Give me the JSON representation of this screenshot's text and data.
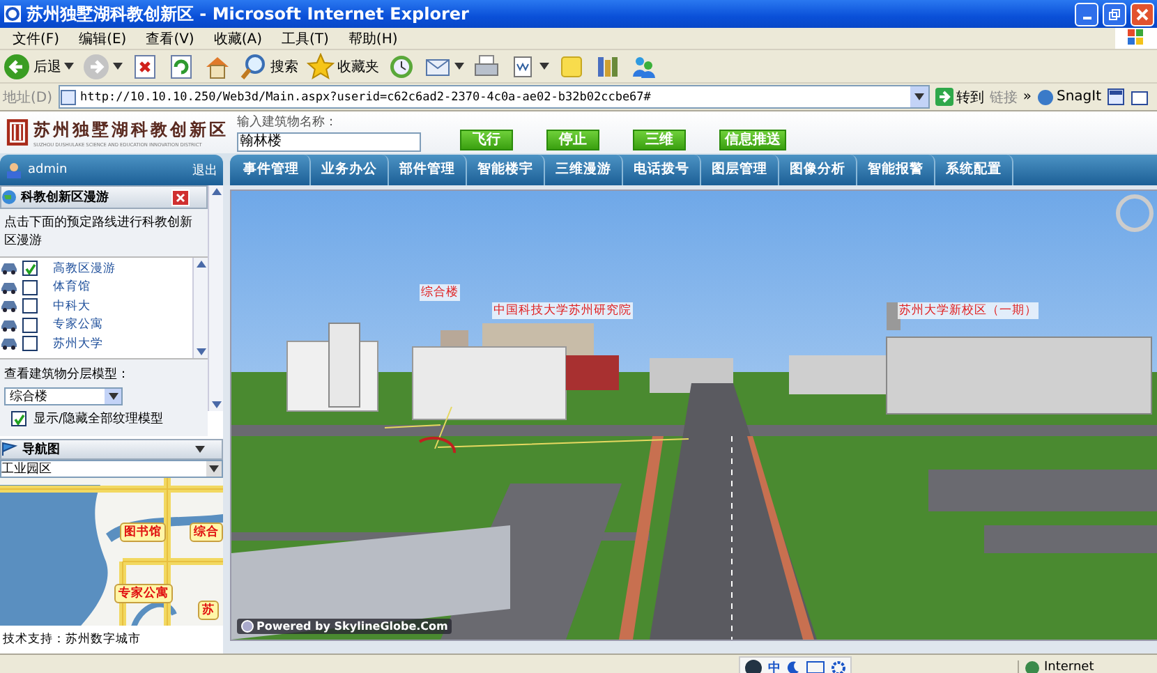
{
  "window": {
    "title": "苏州独墅湖科教创新区 - Microsoft Internet Explorer"
  },
  "menu": [
    "文件(F)",
    "编辑(E)",
    "查看(V)",
    "收藏(A)",
    "工具(T)",
    "帮助(H)"
  ],
  "toolbar": [
    {
      "kind": "back",
      "label": "后退"
    },
    {
      "kind": "forward"
    },
    {
      "kind": "stop"
    },
    {
      "kind": "refresh"
    },
    {
      "kind": "home"
    },
    {
      "kind": "search",
      "label": "搜索"
    },
    {
      "kind": "favorites",
      "label": "收藏夹"
    },
    {
      "kind": "history"
    },
    {
      "kind": "mail"
    },
    {
      "kind": "print"
    },
    {
      "kind": "edit"
    },
    {
      "kind": "note"
    },
    {
      "kind": "research"
    },
    {
      "kind": "messenger"
    }
  ],
  "address_bar": {
    "label": "地址(D)",
    "url": "http://10.10.10.250/Web3d/Main.aspx?userid=c62c6ad2-2370-4c0a-ae02-b32b02ccbe67#",
    "go": "转到",
    "links": "链接",
    "more": "»",
    "snagit": "SnagIt"
  },
  "header": {
    "logo_title": "苏州独墅湖科教创新区",
    "logo_subtitle": "SUZHOU DUSHULAKE SCIENCE AND EDUCATION INNOVATION DISTRICT",
    "search_label": "输入建筑物名称：",
    "search_value": "翰林楼",
    "buttons": [
      "飞行",
      "停止",
      "三维",
      "信息推送"
    ]
  },
  "user": {
    "name": "admin",
    "logout": "退出"
  },
  "nav_tabs": [
    {
      "label": "事件管理",
      "selected": false
    },
    {
      "label": "业务办公",
      "selected": false
    },
    {
      "label": "部件管理",
      "selected": false
    },
    {
      "label": "智能楼宇",
      "selected": false
    },
    {
      "label": "三维漫游",
      "selected": false
    },
    {
      "label": "电话拨号",
      "selected": false
    },
    {
      "label": "图层管理",
      "selected": false
    },
    {
      "label": "图像分析",
      "selected": false
    },
    {
      "label": "智能报警",
      "selected": false
    },
    {
      "label": "系统配置",
      "selected": false
    }
  ],
  "tour_panel": {
    "title": "科教创新区漫游",
    "instruction": "点击下面的预定路线进行科教创新区漫游",
    "routes": [
      {
        "label": "高教区漫游",
        "checked": true
      },
      {
        "label": "体育馆",
        "checked": false
      },
      {
        "label": "中科大",
        "checked": false
      },
      {
        "label": "专家公寓",
        "checked": false
      },
      {
        "label": "苏州大学",
        "checked": false
      }
    ],
    "layer_label": "查看建筑物分层模型：",
    "layer_select": "综合楼",
    "texture_toggle": {
      "label": "显示/隐藏全部纹理模型",
      "checked": true
    }
  },
  "nav_map": {
    "title": "导航图",
    "area_select": "工业园区",
    "labels": [
      "图书馆",
      "综合",
      "专家公寓",
      "苏"
    ]
  },
  "footer": "技术支持：苏州数字城市",
  "scene": {
    "labels": [
      "综合楼",
      "中国科技大学苏州研究院",
      "苏州大学新校区（一期）"
    ],
    "credit": "Powered by SkylineGlobe.Com"
  },
  "status_bar": {
    "ime": "中",
    "zone": "Internet"
  }
}
